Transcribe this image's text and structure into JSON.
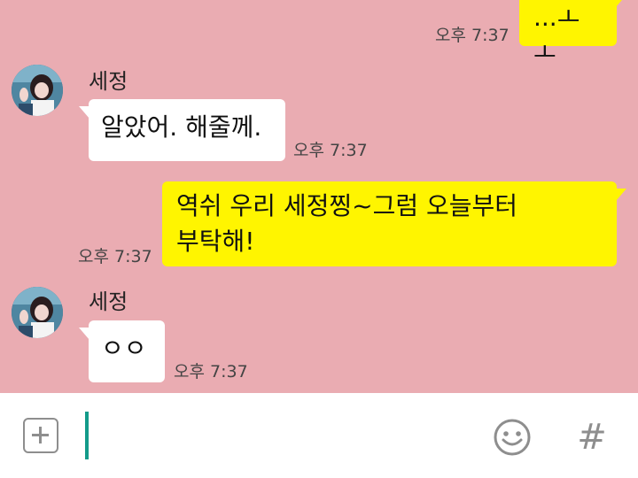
{
  "messages": [
    {
      "direction": "out",
      "text": "...ㅗㅗ",
      "time": "오후 7:37"
    },
    {
      "direction": "in",
      "sender": "세정",
      "text": "알았어. 해줄께.",
      "time": "오후 7:37"
    },
    {
      "direction": "out",
      "text_lines": [
        "역쉬 우리 세정찡~그럼 오늘부터",
        "부탁해!"
      ],
      "time": "오후 7:37"
    },
    {
      "direction": "in",
      "sender": "세정",
      "text": "ㅇㅇ",
      "time": "오후 7:37"
    }
  ],
  "input": {
    "value": "",
    "placeholder": ""
  },
  "icons": {
    "attach": "plus-square-icon",
    "emoticon": "smiley-icon",
    "hashtag": "hash-icon",
    "hash_glyph": "#"
  },
  "colors": {
    "chat_background": "#eaacb2",
    "incoming_bubble": "#ffffff",
    "outgoing_bubble": "#fff500",
    "cursor": "#139b8a",
    "icon_gray": "#8e8e8e"
  }
}
